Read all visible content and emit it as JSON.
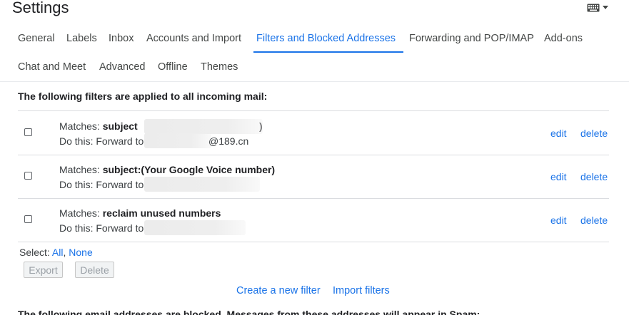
{
  "page": {
    "title": "Settings",
    "keyboard_icon": "keyboard-icon",
    "dropdown_icon": "caret-down-icon"
  },
  "tabs": [
    {
      "label": "General"
    },
    {
      "label": "Labels"
    },
    {
      "label": "Inbox"
    },
    {
      "label": "Accounts and Import"
    },
    {
      "label": "Filters and Blocked Addresses",
      "active": true
    },
    {
      "label": "Forwarding and POP/IMAP"
    },
    {
      "label": "Add-ons"
    },
    {
      "label": "Chat and Meet"
    },
    {
      "label": "Advanced"
    },
    {
      "label": "Offline"
    },
    {
      "label": "Themes"
    }
  ],
  "filters": {
    "heading": "The following filters are applied to all incoming mail:",
    "matches_prefix": "Matches: ",
    "do_prefix": "Do this: Forward to",
    "edit_label": "edit",
    "delete_label": "delete",
    "rows": [
      {
        "criteria": "subject",
        "criteria_tail": ")",
        "action_tail": "@189.cn"
      },
      {
        "criteria": "subject:(Your Google Voice number)",
        "criteria_tail": "",
        "action_tail": ""
      },
      {
        "criteria": "reclaim unused numbers",
        "criteria_tail": "",
        "action_tail": ""
      }
    ]
  },
  "select": {
    "label": "Select: ",
    "all": "All",
    "separator": ", ",
    "none": "None"
  },
  "buttons": {
    "export": "Export",
    "delete": "Delete"
  },
  "links": {
    "create": "Create a new filter",
    "import": "Import filters"
  },
  "next_section": {
    "text": "The following email addresses are blocked. Messages from these addresses will appear in Spam:"
  },
  "colors": {
    "accent": "#1a73e8",
    "text": "#202124",
    "muted": "#3c4043",
    "rule": "#dadce0"
  }
}
